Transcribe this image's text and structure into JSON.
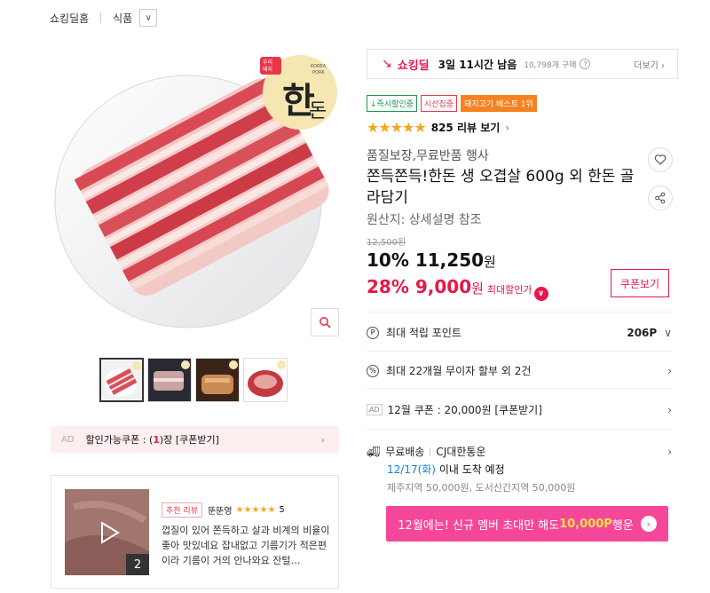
{
  "breadcrumb": {
    "home": "쇼킹딜홈",
    "category": "식품"
  },
  "logo": {
    "text": "한돈",
    "sub": "KOREA PORK",
    "badge": "우리 돼지"
  },
  "coupon_ad": {
    "ad": "AD",
    "text_prefix": "할인가능쿠폰 : (",
    "count": "1",
    "text_suffix": ")장 [쿠폰받기]"
  },
  "review": {
    "badge": "추천 리뷰",
    "user": "뚠뚠영",
    "stars": "★★★★★",
    "score": "5",
    "count": "2",
    "text": "껍질이 있어 쫀득하고 살과 비계의 비율이좋아 맛있네요 잡내없고 기름기가 적은편이라 기름이 거의 안나와요 잔털…"
  },
  "deal": {
    "label": "쇼킹딜",
    "remaining": "3일 11시간 남음",
    "purchased": "10,798개 구매",
    "more": "더보기"
  },
  "badges": [
    {
      "label": "↓즉시할인중",
      "color": "#1a9a4a",
      "bg": "#fff"
    },
    {
      "label": "시선집중",
      "color": "#e8374a",
      "bg": "#fff"
    },
    {
      "label": "돼지고기 베스트 1위",
      "color": "#fff",
      "bg": "#f58220"
    }
  ],
  "rating": {
    "stars": "★★★★★",
    "reviews": "825 리뷰 보기"
  },
  "product": {
    "subtitle": "품질보장,무료반품 행사",
    "title": "쫀득쫀득!한돈 생 오겹살 600g 외 한돈 골라담기",
    "origin": "원산지: 상세설명 참조",
    "orig_price": "12,500원",
    "price1_pct": "10%",
    "price1": "11,250",
    "price2_pct": "28%",
    "price2": "9,000",
    "won": "원",
    "max_label": "최대할인가",
    "coupon_btn": "쿠폰보기"
  },
  "rows": {
    "points_label": "최대 적립 포인트",
    "points_value": "206P",
    "installment": "최대 22개월 무이자 할부 외 2건",
    "coupon_ad": "AD",
    "coupon": "12월 쿠폰 : 20,000원 [쿠폰받기]",
    "delivery": "무료배송",
    "courier": "CJ대한통운",
    "arrival_date": "12/17(화)",
    "arrival_text": " 이내 도착 예정",
    "extra_fee": "제주지역 50,000원, 도서산간지역 50,000원"
  },
  "banner": {
    "prefix": "12월에는! 신규 멤버 초대만 해도 ",
    "highlight": "10,000P",
    "suffix": " 행운"
  }
}
